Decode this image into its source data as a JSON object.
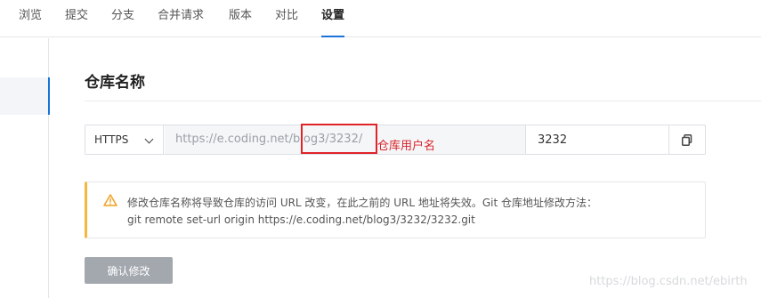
{
  "tabs": [
    {
      "label": "浏览"
    },
    {
      "label": "提交"
    },
    {
      "label": "分支"
    },
    {
      "label": "合并请求"
    },
    {
      "label": "版本"
    },
    {
      "label": "对比"
    },
    {
      "label": "设置",
      "active": true
    }
  ],
  "section": {
    "title": "仓库名称"
  },
  "url_row": {
    "protocol": "HTTPS",
    "prefix": "https://e.coding.net/blog3/3232/",
    "repo_name": "3232",
    "copy_icon": "copy-icon"
  },
  "annotation": {
    "label": "仓库用户名",
    "color": "#e0252a"
  },
  "warning": {
    "icon": "warning-icon",
    "line1": "修改仓库名称将导致仓库的访问 URL 改变，在此之前的 URL 地址将失效。Git 仓库地址修改方法：",
    "line2": "git remote set-url origin https://e.coding.net/blog3/3232/3232.git",
    "accent": "#f4b740"
  },
  "confirm_button": {
    "label": "确认修改"
  },
  "watermark": "https://blog.csdn.net/ebirth",
  "colors": {
    "accent": "#1a73d9",
    "button_disabled": "#a3a8af"
  }
}
